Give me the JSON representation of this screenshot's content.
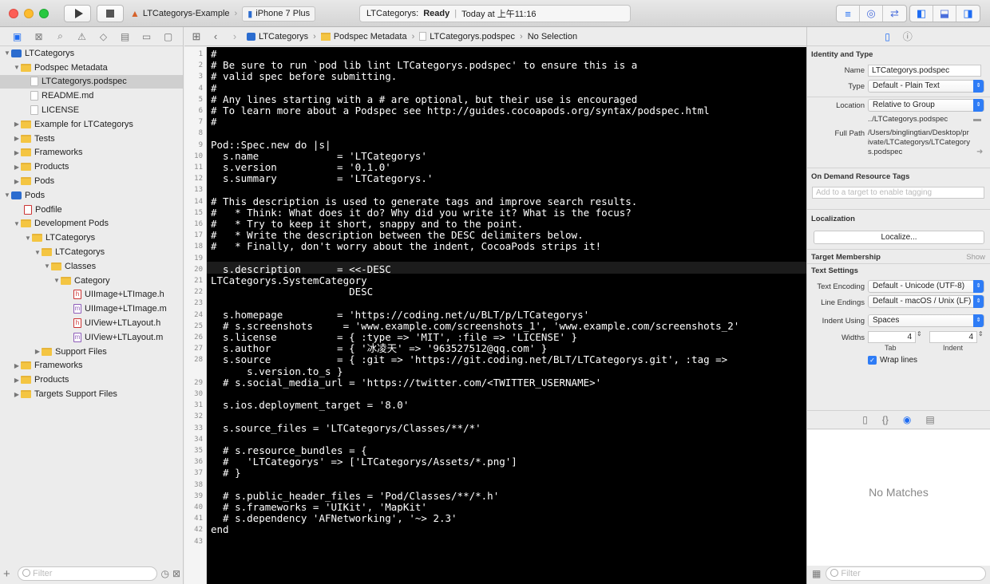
{
  "toolbar": {
    "scheme": "LTCategorys-Example",
    "device": "iPhone 7 Plus",
    "status_app": "LTCategorys:",
    "status_state": "Ready",
    "status_time": "Today at 上午11:16"
  },
  "jumpbar": {
    "crumbs": [
      "LTCategorys",
      "Podspec Metadata",
      "LTCategorys.podspec",
      "No Selection"
    ]
  },
  "navigator": {
    "filter_placeholder": "Filter",
    "items": [
      {
        "label": "LTCategorys"
      },
      {
        "label": "Podspec Metadata"
      },
      {
        "label": "LTCategorys.podspec"
      },
      {
        "label": "README.md"
      },
      {
        "label": "LICENSE"
      },
      {
        "label": "Example for LTCategorys"
      },
      {
        "label": "Tests"
      },
      {
        "label": "Frameworks"
      },
      {
        "label": "Products"
      },
      {
        "label": "Pods"
      },
      {
        "label": "Pods"
      },
      {
        "label": "Podfile"
      },
      {
        "label": "Development Pods"
      },
      {
        "label": "LTCategorys"
      },
      {
        "label": "LTCategorys"
      },
      {
        "label": "Classes"
      },
      {
        "label": "Category"
      },
      {
        "label": "UIImage+LTImage.h"
      },
      {
        "label": "UIImage+LTImage.m"
      },
      {
        "label": "UIView+LTLayout.h"
      },
      {
        "label": "UIView+LTLayout.m"
      },
      {
        "label": "Support Files"
      },
      {
        "label": "Frameworks"
      },
      {
        "label": "Products"
      },
      {
        "label": "Targets Support Files"
      }
    ]
  },
  "editor": {
    "line_numbers": [
      "1",
      "2",
      "3",
      "4",
      "5",
      "6",
      "7",
      "8",
      "9",
      "10",
      "11",
      "12",
      "13",
      "14",
      "15",
      "16",
      "17",
      "18",
      "19",
      "20",
      "21",
      "22",
      "23",
      "24",
      "25",
      "26",
      "27",
      "28",
      "",
      "29",
      "30",
      "31",
      "32",
      "33",
      "34",
      "35",
      "36",
      "37",
      "38",
      "39",
      "40",
      "41",
      "42",
      "43"
    ],
    "lines": [
      "#",
      "# Be sure to run `pod lib lint LTCategorys.podspec' to ensure this is a",
      "# valid spec before submitting.",
      "#",
      "# Any lines starting with a # are optional, but their use is encouraged",
      "# To learn more about a Podspec see http://guides.cocoapods.org/syntax/podspec.html",
      "#",
      "",
      "Pod::Spec.new do |s|",
      "  s.name             = 'LTCategorys'",
      "  s.version          = '0.1.0'",
      "  s.summary          = 'LTCategorys.'",
      "",
      "# This description is used to generate tags and improve search results.",
      "#   * Think: What does it do? Why did you write it? What is the focus?",
      "#   * Try to keep it short, snappy and to the point.",
      "#   * Write the description between the DESC delimiters below.",
      "#   * Finally, don't worry about the indent, CocoaPods strips it!",
      "",
      "  s.description      = <<-DESC",
      "LTCategorys.SystemCategory",
      "                       DESC",
      "",
      "  s.homepage         = 'https://coding.net/u/BLT/p/LTCategorys'",
      "  # s.screenshots     = 'www.example.com/screenshots_1', 'www.example.com/screenshots_2'",
      "  s.license          = { :type => 'MIT', :file => 'LICENSE' }",
      "  s.author           = { '冰凌天' => '963527512@qq.com' }",
      "  s.source           = { :git => 'https://git.coding.net/BLT/LTCategorys.git', :tag =>",
      "      s.version.to_s }",
      "  # s.social_media_url = 'https://twitter.com/<TWITTER_USERNAME>'",
      "",
      "  s.ios.deployment_target = '8.0'",
      "",
      "  s.source_files = 'LTCategorys/Classes/**/*'",
      "",
      "  # s.resource_bundles = {",
      "  #   'LTCategorys' => ['LTCategorys/Assets/*.png']",
      "  # }",
      "",
      "  # s.public_header_files = 'Pod/Classes/**/*.h'",
      "  # s.frameworks = 'UIKit', 'MapKit'",
      "  # s.dependency 'AFNetworking', '~> 2.3'",
      "end",
      ""
    ]
  },
  "inspector": {
    "identity_title": "Identity and Type",
    "name_label": "Name",
    "name_value": "LTCategorys.podspec",
    "type_label": "Type",
    "type_value": "Default - Plain Text",
    "location_label": "Location",
    "location_value": "Relative to Group",
    "location_path": "../LTCategorys.podspec",
    "fullpath_label": "Full Path",
    "fullpath_value": "/Users/binglingtian/Desktop/private/LTCategorys/LTCategorys.podspec",
    "odr_title": "On Demand Resource Tags",
    "odr_placeholder": "Add to a target to enable tagging",
    "localization_title": "Localization",
    "localize_button": "Localize...",
    "target_title": "Target Membership",
    "target_show": "Show",
    "text_settings_title": "Text Settings",
    "encoding_label": "Text Encoding",
    "encoding_value": "Default - Unicode (UTF-8)",
    "endings_label": "Line Endings",
    "endings_value": "Default - macOS / Unix (LF)",
    "indent_label": "Indent Using",
    "indent_value": "Spaces",
    "widths_label": "Widths",
    "tab_value": "4",
    "indent_width_value": "4",
    "tab_caption": "Tab",
    "indent_caption": "Indent",
    "wrap_label": "Wrap lines",
    "no_matches": "No Matches",
    "filter_placeholder": "Filter"
  }
}
